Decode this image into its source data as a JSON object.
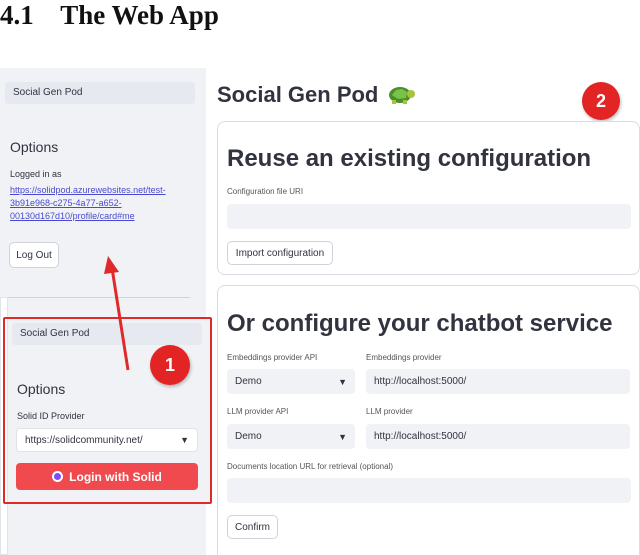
{
  "heading": "4.1    The Web App",
  "sidebar": {
    "app_name": "Social Gen Pod",
    "options_title": "Options",
    "logged_in_as": "Logged in as",
    "webid_lines": [
      "https://solidpod.azurewebsites.net/test-",
      "3b91e968-c275-4a77-a652-",
      "00130d167d10/profile/card#me"
    ],
    "logout_label": "Log Out"
  },
  "login_panel": {
    "app_name": "Social Gen Pod",
    "options_title": "Options",
    "provider_label": "Solid ID Provider",
    "provider_value": "https://solidcommunity.net/",
    "login_label": "Login with Solid"
  },
  "main": {
    "title": "Social Gen Pod",
    "reuse": {
      "title": "Reuse an existing configuration",
      "file_label": "Configuration file URI",
      "import_label": "Import configuration"
    },
    "configure": {
      "title": "Or configure your chatbot service",
      "emb_api_label": "Embeddings provider API",
      "emb_api_value": "Demo",
      "emb_provider_label": "Embeddings provider",
      "emb_provider_value": "http://localhost:5000/",
      "llm_api_label": "LLM provider API",
      "llm_api_value": "Demo",
      "llm_provider_label": "LLM provider",
      "llm_provider_value": "http://localhost:5000/",
      "docs_label": "Documents location URL for retrieval (optional)",
      "confirm_label": "Confirm"
    }
  },
  "badges": [
    "1",
    "2"
  ],
  "colors": {
    "accent_red": "#e02a2a",
    "login_red": "#f04a4f",
    "sidebar_bg": "#f0f2f6"
  },
  "icons": {
    "turtle": "turtle-icon",
    "chevron": "chevron-down-icon",
    "solid_logo": "solid-logo-icon"
  }
}
